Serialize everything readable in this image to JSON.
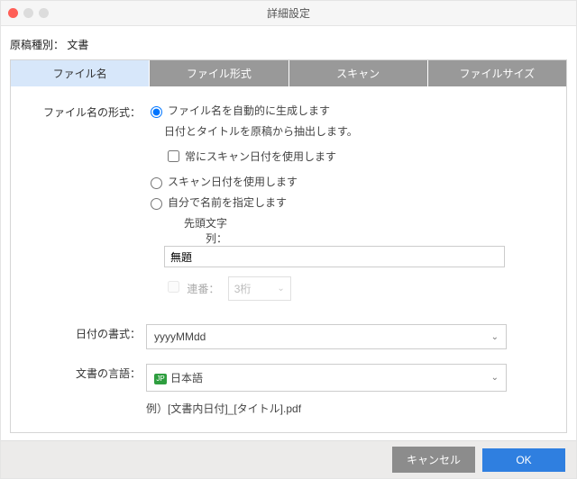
{
  "window": {
    "title": "詳細設定"
  },
  "meta": {
    "label": "原稿種別：",
    "value": "文書"
  },
  "tabs": [
    {
      "label": "ファイル名",
      "active": true
    },
    {
      "label": "ファイル形式",
      "active": false
    },
    {
      "label": "スキャン",
      "active": false
    },
    {
      "label": "ファイルサイズ",
      "active": false
    }
  ],
  "form": {
    "format_label": "ファイル名の形式：",
    "opt_auto": "ファイル名を自動的に生成します",
    "opt_auto_desc": "日付とタイトルを原稿から抽出します。",
    "opt_always_scan_date": "常にスキャン日付を使用します",
    "opt_use_scan_date": "スキャン日付を使用します",
    "opt_specify": "自分で名前を指定します",
    "prefix_label": "先頭文字列：",
    "prefix_value": "無題",
    "serial_label": "連番：",
    "serial_value": "3桁",
    "date_format_label": "日付の書式：",
    "date_format_value": "yyyyMMdd",
    "language_label": "文書の言語：",
    "language_badge": "JP",
    "language_value": "日本語",
    "example": "例）[文書内日付]_[タイトル].pdf"
  },
  "footer": {
    "cancel": "キャンセル",
    "ok": "OK"
  }
}
